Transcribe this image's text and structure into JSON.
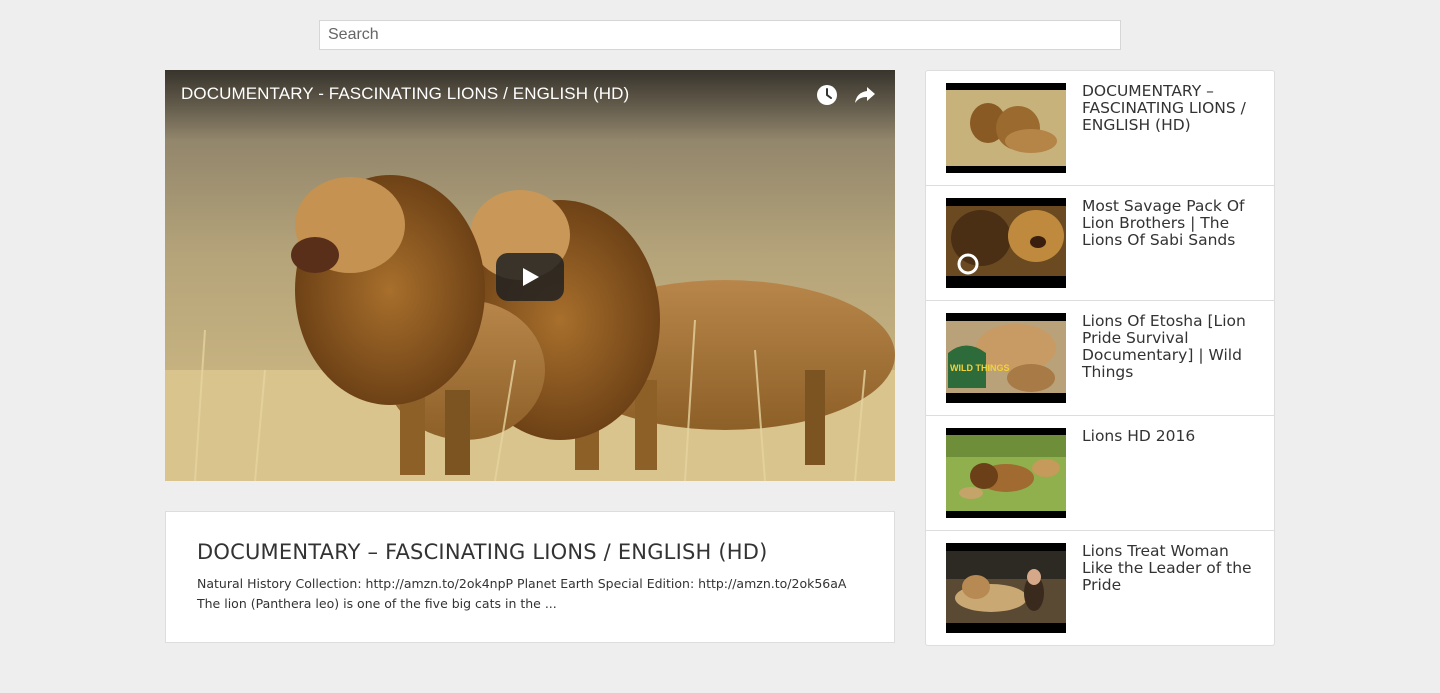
{
  "search": {
    "placeholder": "Search"
  },
  "player": {
    "title": "DOCUMENTARY - FASCINATING LIONS / ENGLISH (HD)",
    "icons": [
      "watch-later-icon",
      "share-icon",
      "play-icon"
    ]
  },
  "info": {
    "title": "DOCUMENTARY – FASCINATING LIONS / ENGLISH (HD)",
    "description": "Natural History Collection: http://amzn.to/2ok4npP Planet Earth Special Edition: http://amzn.to/2ok56aA The lion (Panthera leo) is one of the five big cats in the ..."
  },
  "sidebar": {
    "items": [
      {
        "title": "DOCUMENTARY – FASCINATING LIONS / ENGLISH (HD)"
      },
      {
        "title": "Most Savage Pack Of Lion Brothers | The Lions Of Sabi Sands"
      },
      {
        "title": "Lions Of Etosha [Lion Pride Survival Documentary] | Wild Things",
        "thumb_badge": "WILD THINGS"
      },
      {
        "title": "Lions HD 2016"
      },
      {
        "title": "Lions Treat Woman Like the Leader of the Pride"
      }
    ]
  },
  "colors": {
    "background": "#eeeeee",
    "card": "#ffffff",
    "text": "#333333"
  }
}
